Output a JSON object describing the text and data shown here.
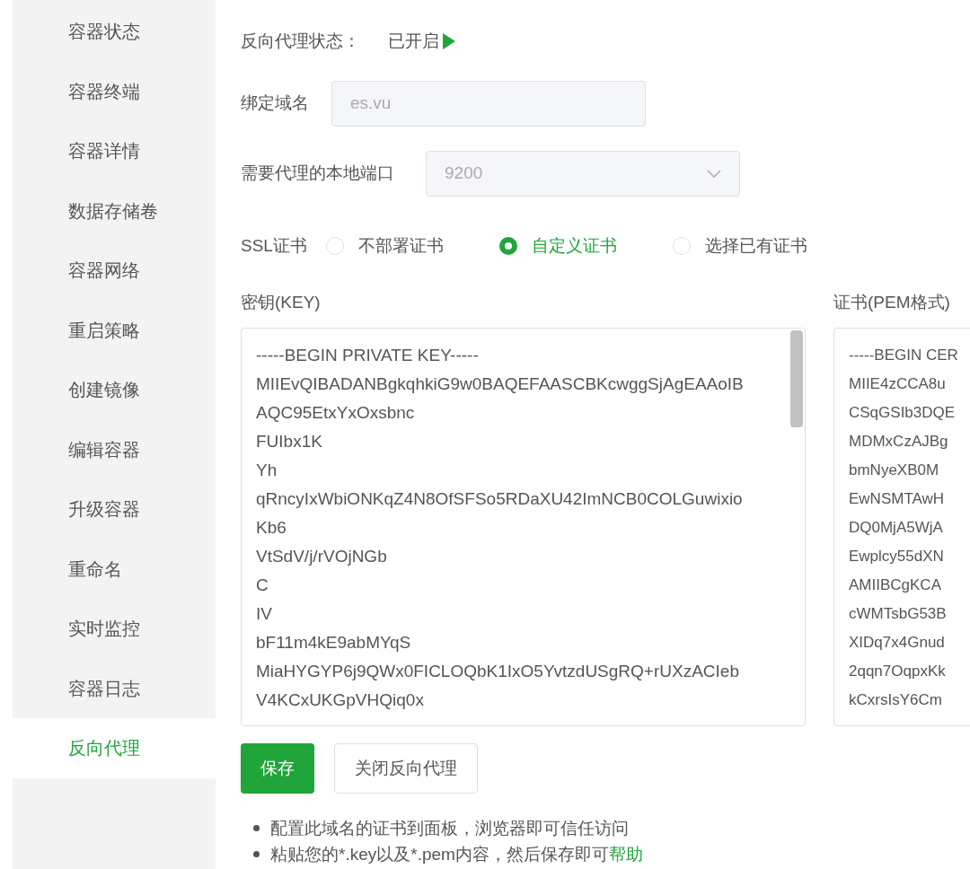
{
  "sidebar": {
    "items": [
      {
        "label": "容器状态",
        "selected": false
      },
      {
        "label": "容器终端",
        "selected": false
      },
      {
        "label": "容器详情",
        "selected": false
      },
      {
        "label": "数据存储卷",
        "selected": false
      },
      {
        "label": "容器网络",
        "selected": false
      },
      {
        "label": "重启策略",
        "selected": false
      },
      {
        "label": "创建镜像",
        "selected": false
      },
      {
        "label": "编辑容器",
        "selected": false
      },
      {
        "label": "升级容器",
        "selected": false
      },
      {
        "label": "重命名",
        "selected": false
      },
      {
        "label": "实时监控",
        "selected": false
      },
      {
        "label": "容器日志",
        "selected": false
      },
      {
        "label": "反向代理",
        "selected": true
      }
    ]
  },
  "status": {
    "label": "反向代理状态：",
    "value": "已开启",
    "on": true
  },
  "domain": {
    "label": "绑定域名",
    "value": "es.vu"
  },
  "port": {
    "label": "需要代理的本地端口",
    "value": "9200"
  },
  "ssl": {
    "label": "SSL证书",
    "options": [
      {
        "label": "不部署证书",
        "selected": false
      },
      {
        "label": "自定义证书",
        "selected": true
      },
      {
        "label": "选择已有证书",
        "selected": false
      }
    ]
  },
  "key": {
    "label": "密钥(KEY)",
    "lines": [
      "-----BEGIN PRIVATE KEY-----",
      "MIIEvQIBADANBgkqhkiG9w0BAQEFAASCBKcwggSjAgEAAoIB",
      "AQC95EtxYxOxsbnc",
      "FUIbx1K",
      "Yh",
      "qRncyIxWbiONKqZ4N8OfSFSo5RDaXU42ImNCB0COLGuwixio",
      "Kb6",
      "VtSdV/j/rVOjNGb",
      "C",
      "IV",
      "bF11m4kE9abMYqS",
      "MiaHYGYP6j9QWx0FICLOQbK1IxO5YvtzdUSgRQ+rUXzACIeb",
      "V4KCxUKGpVHQiq0x"
    ]
  },
  "cert": {
    "label": "证书(PEM格式)",
    "lines": [
      "-----BEGIN CER",
      "MIIE4zCCA8u",
      "CSqGSIb3DQE",
      "MDMxCzAJBg",
      "bmNyeXB0M",
      "EwNSMTAwH",
      "DQ0MjA5WjA",
      "Ewplcy55dXN",
      "AMIIBCgKCA",
      "cWMTsbG53B",
      "XIDq7x4Gnud",
      "2qqn7OqpxKk",
      "kCxrsIsY6Cm"
    ]
  },
  "buttons": [
    {
      "label": "保存",
      "kind": "primary"
    },
    {
      "label": "关闭反向代理",
      "kind": "default"
    }
  ],
  "notes": [
    {
      "text": "配置此域名的证书到面板，浏览器即可信任访问"
    },
    {
      "text": "粘贴您的*.key以及*.pem内容，然后保存即可",
      "link": "帮助"
    }
  ]
}
